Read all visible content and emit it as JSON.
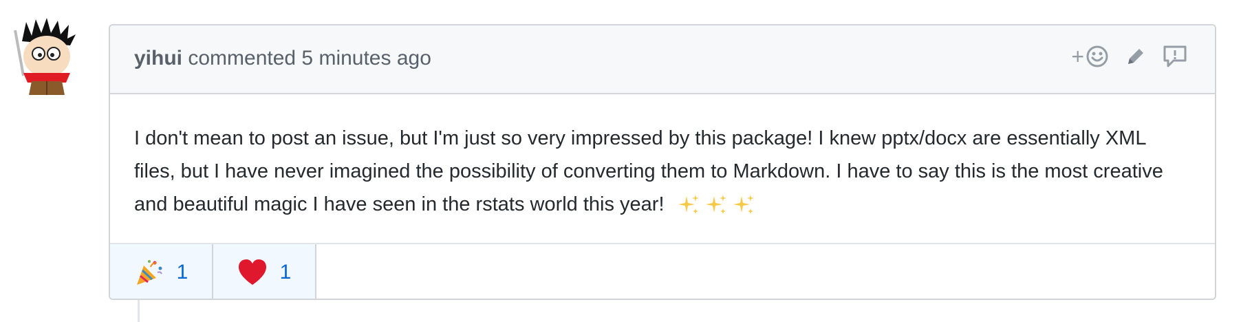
{
  "comment": {
    "author": "yihui",
    "meta": "commented 5 minutes ago",
    "body": "I don't mean to post an issue, but I'm just so very impressed by this package! I knew pptx/docx are essentially XML files, but I have never imagined the possibility of converting them to Markdown. I have to say this is the most creative and beautiful magic I have seen in the rstats world this year!",
    "trailing_emoji": [
      "sparkles-emoji",
      "sparkles-emoji",
      "sparkles-emoji"
    ]
  },
  "actions": {
    "add_reaction_plus": "+",
    "icons": [
      "smiley-icon",
      "pencil-icon",
      "report-icon"
    ]
  },
  "reactions": [
    {
      "emoji": "tada-emoji",
      "count": "1"
    },
    {
      "emoji": "heart-emoji",
      "count": "1"
    }
  ],
  "colors": {
    "header_bg": "#f6f8fa",
    "border": "#d1d5da",
    "reaction_bg": "#f1f8ff",
    "link_blue": "#0366d6",
    "muted_text": "#586069"
  }
}
